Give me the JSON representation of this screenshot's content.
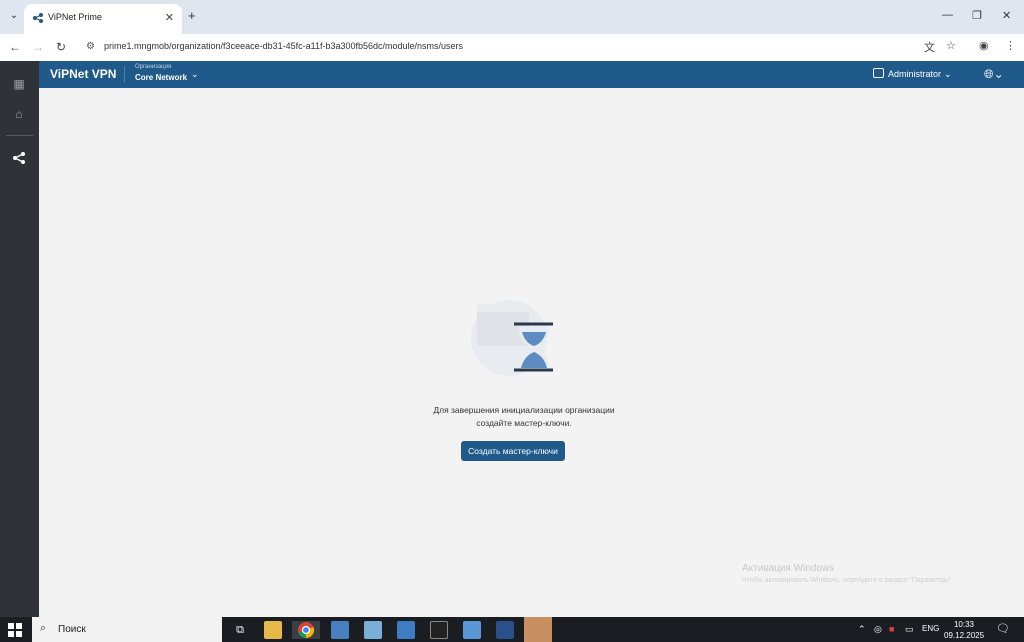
{
  "browser": {
    "tab_title": "ViPNet Prime",
    "url": "prime1.mngmob/organization/f3ceeace-db31-45fc-a11f-b3a300fb56dc/module/nsms/users"
  },
  "app": {
    "brand": "ViPNet VPN",
    "org_label": "Организация",
    "org_name": "Core Network",
    "user": "Administrator"
  },
  "main": {
    "message_line1": "Для завершения инициализации организации",
    "message_line2": "создайте мастер-ключи.",
    "button_label": "Создать мастер-ключи"
  },
  "watermark": {
    "line1": "Активация Windows",
    "line2": "Чтобы активировать Windows, перейдите в раздел \"Параметры\"."
  },
  "taskbar": {
    "search_placeholder": "Поиск",
    "lang": "ENG",
    "time": "10:33",
    "date": "09.12.2025"
  },
  "colors": {
    "accent": "#1f5a8a",
    "sidebar": "#2f3338"
  }
}
